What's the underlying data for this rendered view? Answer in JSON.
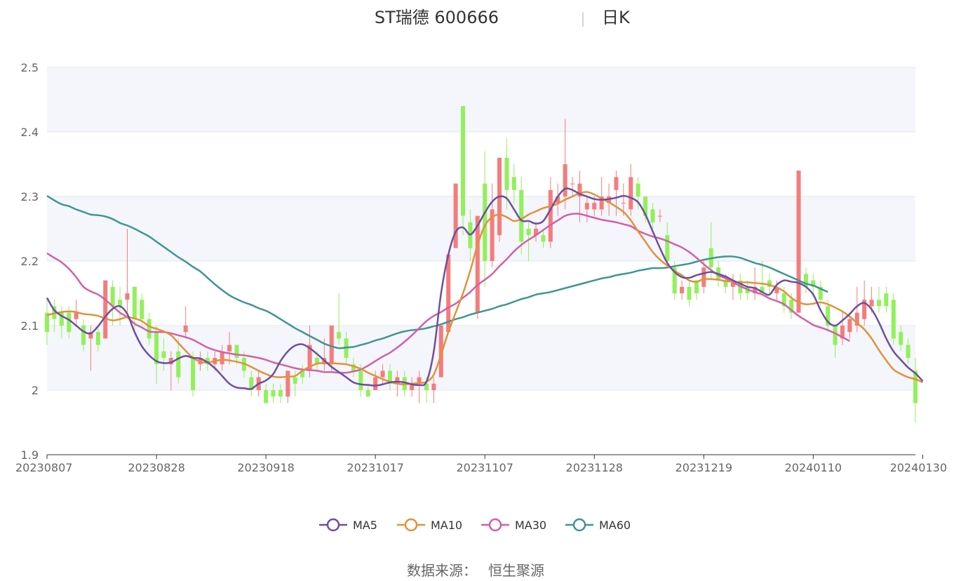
{
  "header": {
    "title_left": "ST瑞德 600666",
    "separator": "|",
    "title_right": "日K"
  },
  "source_label": "数据来源：",
  "source_name": "恒生聚源",
  "colors": {
    "up": "#f47c7c",
    "down": "#92f05a",
    "ma5": "#6e4ea1",
    "ma10": "#e2913b",
    "ma30": "#d45fa8",
    "ma60": "#3f9690",
    "band": "#f4f6fb",
    "grid": "#e1e5ee",
    "axis": "#333333"
  },
  "chart_data": {
    "type": "candlestick",
    "ylim": [
      1.9,
      2.5
    ],
    "yticks": [
      1.9,
      2,
      2.1,
      2.2,
      2.3,
      2.4,
      2.5
    ],
    "ytick_labels": [
      "1.9",
      "2",
      "2.1",
      "2.2",
      "2.3",
      "2.4",
      "2.5"
    ],
    "x_tick_labels": [
      "20230807",
      "20230828",
      "20230918",
      "20231017",
      "20231107",
      "20231128",
      "20231219",
      "20240110",
      "20240130"
    ],
    "x_tick_index": [
      0,
      15,
      30,
      45,
      60,
      75,
      90,
      105,
      120
    ],
    "legend": [
      {
        "name": "MA5",
        "color_key": "ma5"
      },
      {
        "name": "MA10",
        "color_key": "ma10"
      },
      {
        "name": "MA30",
        "color_key": "ma30"
      },
      {
        "name": "MA60",
        "color_key": "ma60"
      }
    ],
    "candles": [
      [
        2.12,
        2.09,
        2.14,
        2.07
      ],
      [
        2.13,
        2.11,
        2.14,
        2.09
      ],
      [
        2.12,
        2.1,
        2.13,
        2.08
      ],
      [
        2.12,
        2.09,
        2.13,
        2.08
      ],
      [
        2.11,
        2.12,
        2.14,
        2.1
      ],
      [
        2.1,
        2.07,
        2.11,
        2.06
      ],
      [
        2.08,
        2.09,
        2.1,
        2.03
      ],
      [
        2.09,
        2.07,
        2.1,
        2.06
      ],
      [
        2.08,
        2.17,
        2.17,
        2.08
      ],
      [
        2.16,
        2.13,
        2.17,
        2.1
      ],
      [
        2.14,
        2.13,
        2.16,
        2.1
      ],
      [
        2.14,
        2.15,
        2.25,
        2.12
      ],
      [
        2.16,
        2.11,
        2.16,
        2.09
      ],
      [
        2.14,
        2.11,
        2.15,
        2.1
      ],
      [
        2.11,
        2.08,
        2.12,
        2.07
      ],
      [
        2.09,
        2.04,
        2.1,
        2.01
      ],
      [
        2.06,
        2.05,
        2.08,
        2.03
      ],
      [
        2.04,
        2.05,
        2.06,
        2.0
      ],
      [
        2.06,
        2.02,
        2.08,
        2.01
      ],
      [
        2.09,
        2.1,
        2.13,
        2.08
      ],
      [
        2.05,
        2.0,
        2.06,
        1.99
      ],
      [
        2.04,
        2.05,
        2.06,
        2.03
      ],
      [
        2.05,
        2.04,
        2.06,
        2.03
      ],
      [
        2.04,
        2.05,
        2.06,
        2.03
      ],
      [
        2.04,
        2.06,
        2.07,
        2.03
      ],
      [
        2.06,
        2.07,
        2.09,
        2.04
      ],
      [
        2.07,
        2.05,
        2.07,
        2.04
      ],
      [
        2.05,
        2.03,
        2.06,
        2.02
      ],
      [
        2.02,
        2.0,
        2.03,
        1.99
      ],
      [
        2.0,
        2.02,
        2.03,
        1.99
      ],
      [
        2.0,
        1.98,
        2.01,
        1.98
      ],
      [
        2.0,
        1.99,
        2.01,
        1.98
      ],
      [
        2.0,
        1.99,
        2.01,
        1.98
      ],
      [
        1.99,
        2.03,
        2.03,
        1.98
      ],
      [
        2.02,
        2.01,
        2.03,
        1.99
      ],
      [
        2.03,
        2.02,
        2.04,
        2.01
      ],
      [
        2.03,
        2.07,
        2.1,
        2.02
      ],
      [
        2.05,
        2.04,
        2.06,
        2.03
      ],
      [
        2.04,
        2.05,
        2.08,
        2.03
      ],
      [
        2.04,
        2.1,
        2.1,
        2.03
      ],
      [
        2.09,
        2.08,
        2.15,
        2.07
      ],
      [
        2.08,
        2.05,
        2.09,
        2.04
      ],
      [
        2.04,
        2.03,
        2.05,
        2.02
      ],
      [
        2.03,
        2.0,
        2.04,
        1.99
      ],
      [
        2.0,
        1.99,
        2.01,
        1.99
      ],
      [
        2.0,
        2.02,
        2.03,
        2.0
      ],
      [
        2.02,
        2.03,
        2.04,
        2.01
      ],
      [
        2.03,
        2.01,
        2.04,
        2.0
      ],
      [
        2.01,
        2.02,
        2.03,
        1.99
      ],
      [
        2.02,
        2.0,
        2.03,
        1.99
      ],
      [
        2.0,
        2.01,
        2.02,
        1.99
      ],
      [
        2.01,
        2.02,
        2.03,
        1.98
      ],
      [
        2.01,
        2.0,
        2.02,
        1.98
      ],
      [
        2.0,
        2.01,
        2.02,
        1.98
      ],
      [
        2.02,
        2.1,
        2.1,
        2.02
      ],
      [
        2.09,
        2.21,
        2.21,
        2.09
      ],
      [
        2.22,
        2.32,
        2.32,
        2.22
      ],
      [
        2.44,
        2.27,
        2.44,
        2.24
      ],
      [
        2.26,
        2.22,
        2.28,
        2.2
      ],
      [
        2.12,
        2.27,
        2.27,
        2.11
      ],
      [
        2.32,
        2.2,
        2.37,
        2.16
      ],
      [
        2.2,
        2.28,
        2.32,
        2.19
      ],
      [
        2.24,
        2.36,
        2.36,
        2.23
      ],
      [
        2.36,
        2.31,
        2.39,
        2.28
      ],
      [
        2.33,
        2.31,
        2.35,
        2.29
      ],
      [
        2.31,
        2.23,
        2.33,
        2.21
      ],
      [
        2.25,
        2.24,
        2.26,
        2.2
      ],
      [
        2.24,
        2.25,
        2.26,
        2.23
      ],
      [
        2.24,
        2.23,
        2.25,
        2.22
      ],
      [
        2.23,
        2.31,
        2.33,
        2.22
      ],
      [
        2.29,
        2.3,
        2.32,
        2.27
      ],
      [
        2.3,
        2.35,
        2.42,
        2.28
      ],
      [
        2.32,
        2.32,
        2.33,
        2.3
      ],
      [
        2.3,
        2.32,
        2.34,
        2.26
      ],
      [
        2.28,
        2.29,
        2.3,
        2.26
      ],
      [
        2.28,
        2.29,
        2.3,
        2.27
      ],
      [
        2.28,
        2.3,
        2.33,
        2.27
      ],
      [
        2.29,
        2.3,
        2.32,
        2.27
      ],
      [
        2.31,
        2.33,
        2.34,
        2.27
      ],
      [
        2.29,
        2.29,
        2.32,
        2.27
      ],
      [
        2.28,
        2.33,
        2.35,
        2.27
      ],
      [
        2.32,
        2.3,
        2.33,
        2.28
      ],
      [
        2.3,
        2.27,
        2.3,
        2.26
      ],
      [
        2.28,
        2.26,
        2.29,
        2.25
      ],
      [
        2.27,
        2.27,
        2.28,
        2.26
      ],
      [
        2.24,
        2.2,
        2.26,
        2.19
      ],
      [
        2.19,
        2.15,
        2.2,
        2.14
      ],
      [
        2.15,
        2.16,
        2.17,
        2.14
      ],
      [
        2.16,
        2.14,
        2.17,
        2.13
      ],
      [
        2.17,
        2.15,
        2.17,
        2.14
      ],
      [
        2.16,
        2.19,
        2.2,
        2.15
      ],
      [
        2.22,
        2.19,
        2.26,
        2.17
      ],
      [
        2.19,
        2.17,
        2.2,
        2.16
      ],
      [
        2.17,
        2.16,
        2.18,
        2.15
      ],
      [
        2.16,
        2.17,
        2.18,
        2.14
      ],
      [
        2.17,
        2.15,
        2.18,
        2.14
      ],
      [
        2.16,
        2.15,
        2.17,
        2.14
      ],
      [
        2.15,
        2.16,
        2.19,
        2.14
      ],
      [
        2.16,
        2.15,
        2.2,
        2.15
      ],
      [
        2.17,
        2.16,
        2.18,
        2.15
      ],
      [
        2.15,
        2.16,
        2.17,
        2.14
      ],
      [
        2.15,
        2.13,
        2.16,
        2.12
      ],
      [
        2.14,
        2.12,
        2.15,
        2.11
      ],
      [
        2.12,
        2.34,
        2.34,
        2.12
      ],
      [
        2.18,
        2.16,
        2.19,
        2.15
      ],
      [
        2.17,
        2.16,
        2.18,
        2.15
      ],
      [
        2.16,
        2.14,
        2.17,
        2.13
      ],
      [
        2.13,
        2.1,
        2.14,
        2.09
      ],
      [
        2.1,
        2.07,
        2.1,
        2.05
      ],
      [
        2.08,
        2.1,
        2.12,
        2.07
      ],
      [
        2.09,
        2.11,
        2.12,
        2.08
      ],
      [
        2.1,
        2.12,
        2.16,
        2.09
      ],
      [
        2.11,
        2.14,
        2.17,
        2.1
      ],
      [
        2.13,
        2.14,
        2.16,
        2.12
      ],
      [
        2.14,
        2.13,
        2.16,
        2.12
      ],
      [
        2.15,
        2.13,
        2.16,
        2.12
      ],
      [
        2.14,
        2.08,
        2.15,
        2.07
      ],
      [
        2.09,
        2.07,
        2.1,
        2.06
      ],
      [
        2.07,
        2.05,
        2.08,
        2.04
      ],
      [
        2.03,
        1.98,
        2.05,
        1.95
      ]
    ],
    "ma5": [
      2.143,
      2.124,
      2.115,
      2.109,
      2.1,
      2.091,
      2.088,
      2.099,
      2.114,
      2.126,
      2.13,
      2.118,
      2.09,
      2.068,
      2.054,
      2.045,
      2.042,
      2.043,
      2.049,
      2.053,
      2.05,
      2.049,
      2.043,
      2.034,
      2.022,
      2.01,
      2.004,
      2.003,
      2.002,
      2.01,
      2.015,
      2.025,
      2.045,
      2.06,
      2.069,
      2.071,
      2.065,
      2.056,
      2.046,
      2.036,
      2.028,
      2.02,
      2.012,
      2.009,
      2.008,
      2.007,
      2.009,
      2.012,
      2.013,
      2.012,
      2.009,
      2.008,
      2.013,
      2.06,
      2.15,
      2.21,
      2.245,
      2.252,
      2.241,
      2.255,
      2.275,
      2.292,
      2.3,
      2.297,
      2.28,
      2.263,
      2.262,
      2.258,
      2.262,
      2.28,
      2.3,
      2.312,
      2.31,
      2.304,
      2.3,
      2.296,
      2.295,
      2.296,
      2.298,
      2.301,
      2.298,
      2.291,
      2.272,
      2.246,
      2.22,
      2.197,
      2.183,
      2.175,
      2.174,
      2.178,
      2.181,
      2.183,
      2.18,
      2.176,
      2.17,
      2.165,
      2.16,
      2.158,
      2.152,
      2.148,
      2.163,
      2.17,
      2.168,
      2.166,
      2.16,
      2.148,
      2.124,
      2.106,
      2.1,
      2.108,
      2.118,
      2.13,
      2.135,
      2.125,
      2.105,
      2.08,
      2.06,
      2.047,
      2.035,
      2.026,
      2.014
    ],
    "ma10": [
      2.116,
      2.119,
      2.121,
      2.122,
      2.121,
      2.118,
      2.117,
      2.115,
      2.111,
      2.108,
      2.11,
      2.113,
      2.111,
      2.107,
      2.099,
      2.095,
      2.091,
      2.085,
      2.073,
      2.061,
      2.05,
      2.044,
      2.043,
      2.045,
      2.047,
      2.046,
      2.044,
      2.041,
      2.036,
      2.03,
      2.025,
      2.021,
      2.02,
      2.021,
      2.022,
      2.03,
      2.036,
      2.041,
      2.042,
      2.042,
      2.041,
      2.04,
      2.037,
      2.033,
      2.027,
      2.022,
      2.017,
      2.013,
      2.01,
      2.009,
      2.01,
      2.011,
      2.013,
      2.024,
      2.055,
      2.09,
      2.12,
      2.15,
      2.185,
      2.225,
      2.255,
      2.268,
      2.272,
      2.268,
      2.262,
      2.265,
      2.272,
      2.277,
      2.282,
      2.285,
      2.289,
      2.295,
      2.3,
      2.305,
      2.307,
      2.303,
      2.297,
      2.291,
      2.284,
      2.276,
      2.263,
      2.246,
      2.23,
      2.214,
      2.202,
      2.193,
      2.185,
      2.178,
      2.17,
      2.168,
      2.172,
      2.172,
      2.171,
      2.169,
      2.168,
      2.167,
      2.167,
      2.166,
      2.165,
      2.163,
      2.159,
      2.153,
      2.143,
      2.136,
      2.133,
      2.134,
      2.136,
      2.133,
      2.128,
      2.122,
      2.114,
      2.104,
      2.094,
      2.08,
      2.062,
      2.046,
      2.032,
      2.025,
      2.02,
      2.017,
      2.012
    ],
    "ma30": [
      2.212,
      2.205,
      2.198,
      2.188,
      2.175,
      2.16,
      2.153,
      2.148,
      2.14,
      2.13,
      2.12,
      2.113,
      2.103,
      2.097,
      2.091,
      2.09,
      2.09,
      2.088,
      2.085,
      2.082,
      2.078,
      2.072,
      2.066,
      2.062,
      2.059,
      2.057,
      2.055,
      2.054,
      2.052,
      2.05,
      2.047,
      2.043,
      2.04,
      2.037,
      2.034,
      2.032,
      2.031,
      2.03,
      2.028,
      2.028,
      2.027,
      2.027,
      2.029,
      2.032,
      2.038,
      2.045,
      2.052,
      2.058,
      2.066,
      2.075,
      2.085,
      2.096,
      2.107,
      2.115,
      2.121,
      2.128,
      2.134,
      2.143,
      2.152,
      2.163,
      2.171,
      2.18,
      2.192,
      2.203,
      2.215,
      2.225,
      2.233,
      2.24,
      2.248,
      2.256,
      2.263,
      2.27,
      2.273,
      2.273,
      2.27,
      2.267,
      2.264,
      2.262,
      2.26,
      2.257,
      2.254,
      2.247,
      2.242,
      2.238,
      2.235,
      2.231,
      2.226,
      2.221,
      2.214,
      2.205,
      2.195,
      2.186,
      2.178,
      2.173,
      2.167,
      2.161,
      2.156,
      2.152,
      2.148,
      2.142,
      2.138,
      2.133,
      2.124,
      2.115,
      2.108,
      2.101,
      2.097,
      2.093,
      2.088,
      2.082,
      2.076
    ],
    "ma60": [
      2.301,
      2.294,
      2.288,
      2.285,
      2.28,
      2.276,
      2.272,
      2.271,
      2.269,
      2.265,
      2.259,
      2.255,
      2.25,
      2.244,
      2.238,
      2.23,
      2.222,
      2.214,
      2.206,
      2.199,
      2.191,
      2.184,
      2.174,
      2.164,
      2.155,
      2.147,
      2.141,
      2.136,
      2.132,
      2.127,
      2.123,
      2.117,
      2.11,
      2.103,
      2.096,
      2.09,
      2.084,
      2.078,
      2.072,
      2.068,
      2.065,
      2.066,
      2.067,
      2.07,
      2.073,
      2.077,
      2.08,
      2.084,
      2.088,
      2.091,
      2.093,
      2.094,
      2.096,
      2.099,
      2.102,
      2.106,
      2.11,
      2.113,
      2.117,
      2.12,
      2.123,
      2.126,
      2.13,
      2.133,
      2.137,
      2.141,
      2.144,
      2.148,
      2.15,
      2.152,
      2.155,
      2.158,
      2.161,
      2.164,
      2.167,
      2.17,
      2.173,
      2.175,
      2.178,
      2.18,
      2.182,
      2.185,
      2.187,
      2.189,
      2.189,
      2.19,
      2.192,
      2.194,
      2.196,
      2.199,
      2.202,
      2.204,
      2.206,
      2.207,
      2.207,
      2.205,
      2.201,
      2.197,
      2.194,
      2.19,
      2.185,
      2.18,
      2.175,
      2.17,
      2.165,
      2.162,
      2.157,
      2.152
    ]
  }
}
